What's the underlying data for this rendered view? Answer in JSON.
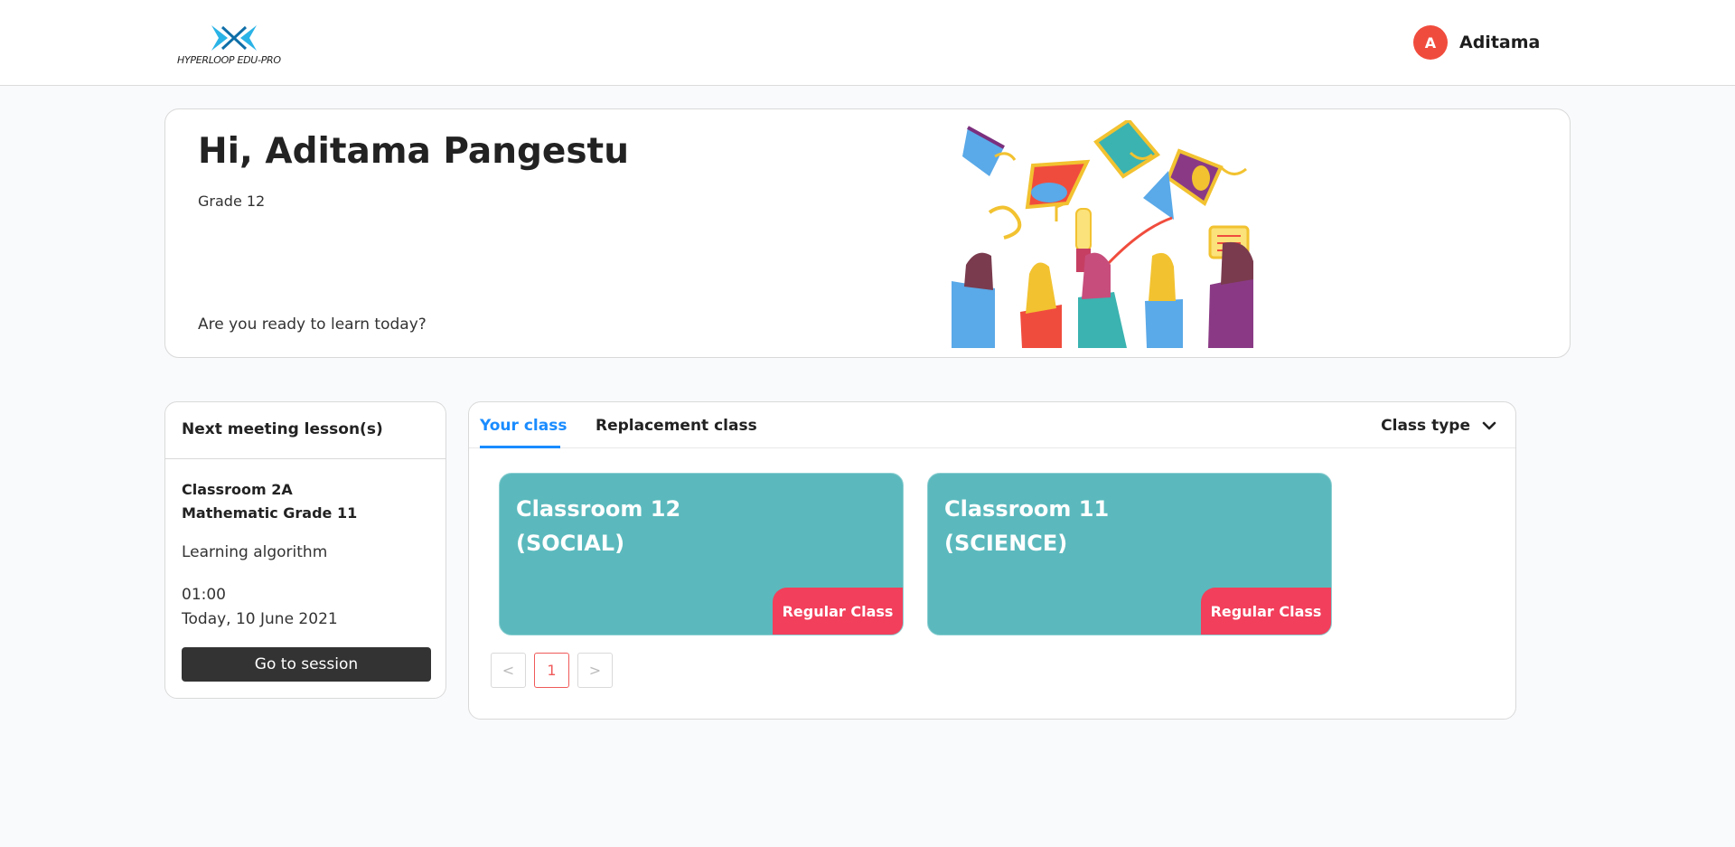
{
  "header": {
    "logo_text": "HYPERLOOP EDU-PRO",
    "user_initial": "A",
    "user_name": "Aditama"
  },
  "welcome": {
    "greeting": "Hi, Aditama Pangestu",
    "grade": "Grade 12",
    "prompt": "Are you ready to learn today?"
  },
  "meeting": {
    "title": "Next meeting lesson(s)",
    "classroom": "Classroom 2A",
    "subject": "Mathematic Grade 11",
    "topic": "Learning algorithm",
    "time": "01:00",
    "date": "Today, 10 June 2021",
    "button_label": "Go to session"
  },
  "classes": {
    "tabs": [
      {
        "label": "Your class",
        "active": true
      },
      {
        "label": "Replacement class",
        "active": false
      }
    ],
    "filter_label": "Class type",
    "cards": [
      {
        "title": "Classroom 12\n(SOCIAL)",
        "badge": "Regular Class"
      },
      {
        "title": "Classroom 11\n(SCIENCE)",
        "badge": "Regular Class"
      }
    ],
    "pagination": {
      "prev": "<",
      "current": "1",
      "next": ">"
    }
  },
  "colors": {
    "accent": "#1a8cff",
    "card": "#5bb9bd",
    "badge": "#f23f5b",
    "avatar": "#f04c3d"
  }
}
